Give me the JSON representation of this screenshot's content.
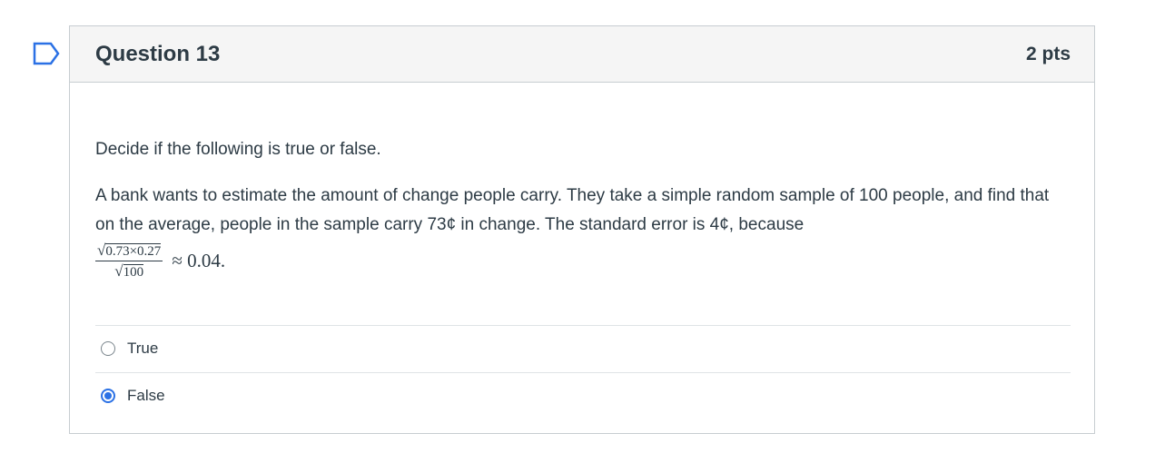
{
  "question": {
    "title": "Question 13",
    "points": "2 pts",
    "intro": "Decide if the following is true or false.",
    "text": "A bank wants to estimate the amount of change people carry. They take a simple random sample of 100 people, and find that on the average, people in the sample carry 73¢ in change. The standard error is 4¢, because",
    "formula": {
      "numerator_radical": "√",
      "numerator_body": "0.73×0.27",
      "denominator_radical": "√",
      "denominator_body": "100",
      "result": "≈ 0.04."
    },
    "answers": [
      {
        "label": "True",
        "selected": false
      },
      {
        "label": "False",
        "selected": true
      }
    ]
  },
  "flag_icon": "bookmark-flag-icon",
  "colors": {
    "accent": "#2b71e5",
    "text": "#2d3b45",
    "header_bg": "#f5f5f5",
    "border": "#c7cdd1",
    "flag": "#2b71e5"
  }
}
